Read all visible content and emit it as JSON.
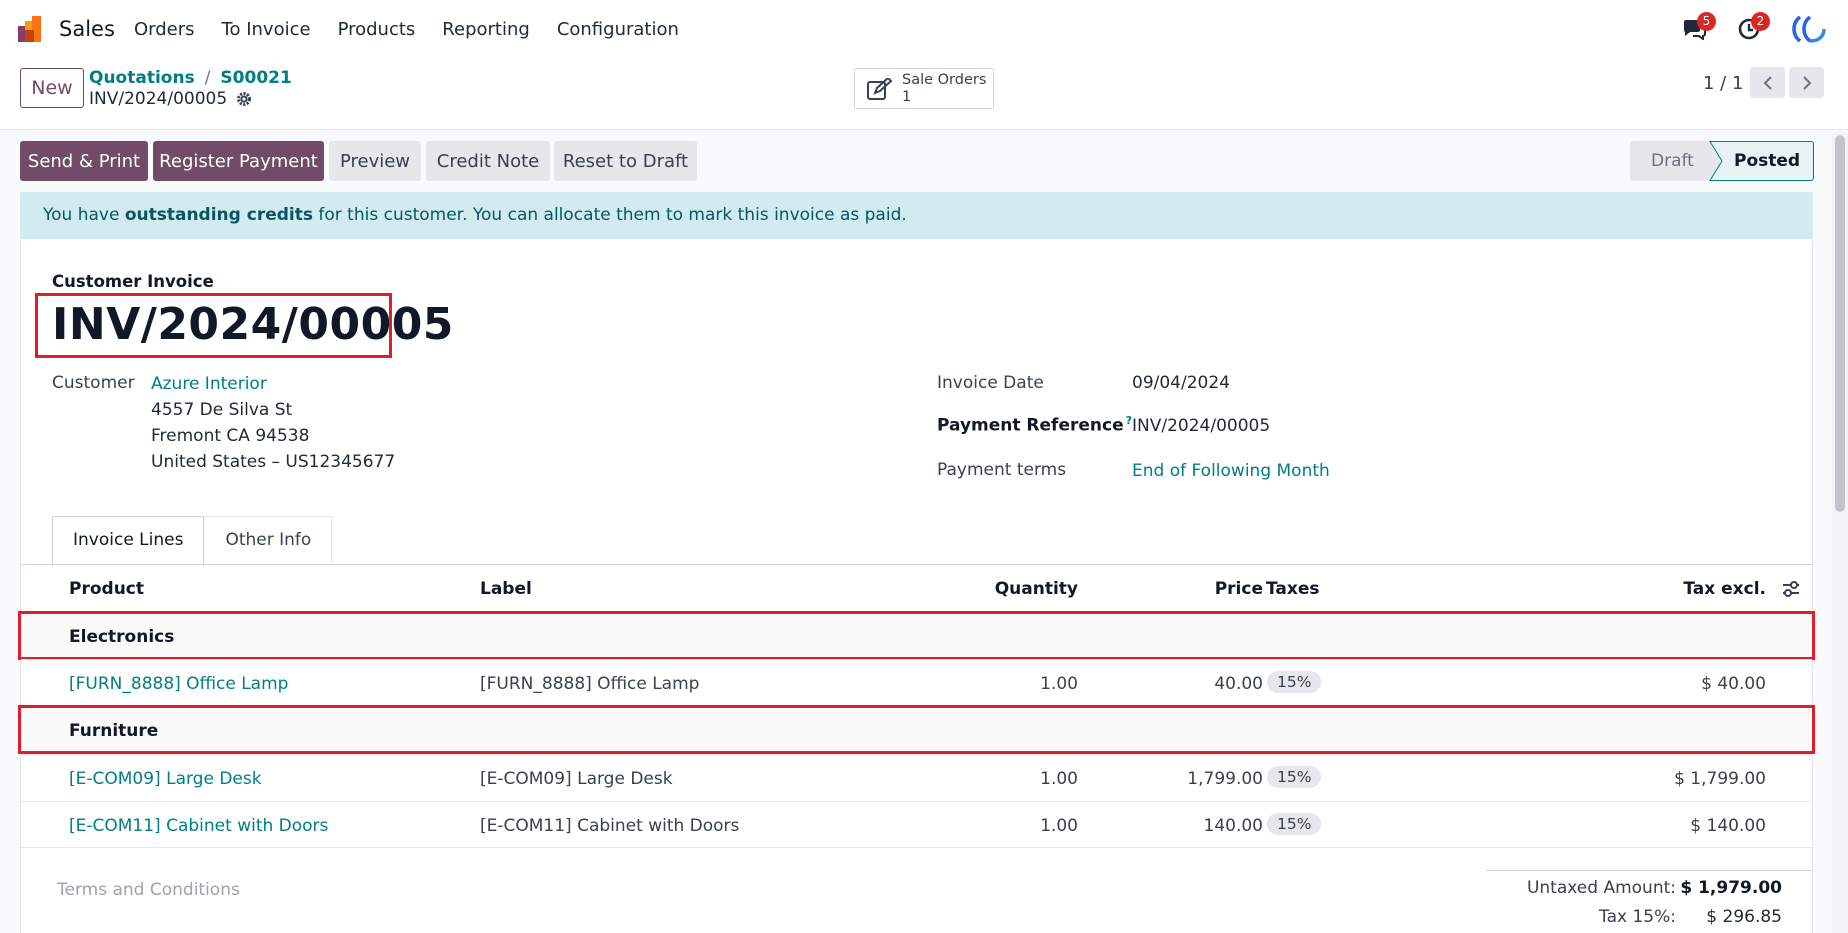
{
  "navbar": {
    "app_name": "Sales",
    "menu": [
      "Orders",
      "To Invoice",
      "Products",
      "Reporting",
      "Configuration"
    ],
    "messages_badge": "5",
    "activities_badge": "2"
  },
  "control": {
    "new_label": "New",
    "breadcrumb": [
      "Quotations",
      "S00021"
    ],
    "record_name": "INV/2024/00005",
    "smart_button": {
      "label": "Sale Orders",
      "count": "1"
    },
    "pager": "1 / 1"
  },
  "statusbar": {
    "buttons": [
      "Send & Print",
      "Register Payment",
      "Preview",
      "Credit Note",
      "Reset to Draft"
    ],
    "steps": [
      "Draft",
      "Posted"
    ],
    "active_step": "Posted"
  },
  "alert": {
    "prefix": "You have ",
    "bold": "outstanding credits",
    "suffix": " for this customer. You can allocate them to mark this invoice as paid."
  },
  "invoice": {
    "doc_type": "Customer Invoice",
    "number": "INV/2024/00005",
    "customer_label": "Customer",
    "customer_name": "Azure Interior",
    "address": [
      "4557 De Silva St",
      "Fremont CA 94538",
      "United States – US12345677"
    ],
    "invoice_date_label": "Invoice Date",
    "invoice_date": "09/04/2024",
    "payment_ref_label": "Payment Reference",
    "payment_ref_help": "?",
    "payment_ref": "INV/2024/00005",
    "payment_terms_label": "Payment terms",
    "payment_terms": "End of Following Month"
  },
  "tabs": [
    "Invoice Lines",
    "Other Info"
  ],
  "table": {
    "headers": {
      "product": "Product",
      "label": "Label",
      "quantity": "Quantity",
      "price": "Price",
      "taxes": "Taxes",
      "tax_excl": "Tax excl."
    },
    "rows": [
      {
        "section": "Electronics"
      },
      {
        "product": "[FURN_8888] Office Lamp",
        "label": "[FURN_8888] Office Lamp",
        "quantity": "1.00",
        "price": "40.00",
        "tax": "15%",
        "subtotal": "$ 40.00"
      },
      {
        "section": "Furniture"
      },
      {
        "product": "[E-COM09] Large Desk",
        "label": "[E-COM09] Large Desk",
        "quantity": "1.00",
        "price": "1,799.00",
        "tax": "15%",
        "subtotal": "$ 1,799.00"
      },
      {
        "product": "[E-COM11] Cabinet with Doors",
        "label": "[E-COM11] Cabinet with Doors",
        "quantity": "1.00",
        "price": "140.00",
        "tax": "15%",
        "subtotal": "$ 140.00"
      }
    ]
  },
  "footer": {
    "terms_placeholder": "Terms and Conditions",
    "untaxed_label": "Untaxed Amount:",
    "untaxed_value": "$ 1,979.00",
    "tax_label": "Tax 15%:",
    "tax_value": "$ 296.85"
  },
  "colors": {
    "primary": "#714b67",
    "link": "#017e84",
    "highlight": "#e11d2a",
    "alert_bg": "#d1ecf1"
  }
}
